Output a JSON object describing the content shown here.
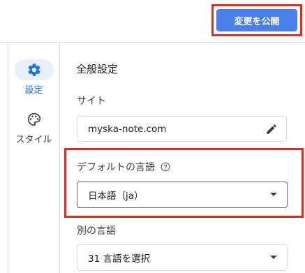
{
  "header": {
    "publish_label": "変更を公開"
  },
  "sidebar": {
    "items": [
      {
        "label": "設定",
        "icon": "gear-icon",
        "active": true
      },
      {
        "label": "スタイル",
        "icon": "palette-icon",
        "active": false
      }
    ]
  },
  "main": {
    "title": "全般設定",
    "site": {
      "label": "サイト",
      "value": "myska-note.com"
    },
    "default_language": {
      "label": "デフォルトの言語",
      "selected": "日本語（ja）"
    },
    "other_languages": {
      "label": "別の言語",
      "selected": "31 言語を選択"
    }
  },
  "colors": {
    "accent": "#4a7ee8",
    "highlight_box": "#d93025",
    "active_nav_bg": "#e8f0fe",
    "active_nav_text": "#1a73e8"
  }
}
